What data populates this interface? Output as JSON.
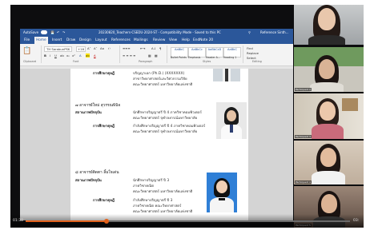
{
  "word": {
    "title": "20230820_Teachers-CSEDU-2024-ST - Compatibility Mode - Saved to this PC",
    "autosave_label": "AutoSave",
    "search_label": "Search",
    "account_label": "Reference Sinth...",
    "tabs": [
      "File",
      "Home",
      "Insert",
      "Draw",
      "Design",
      "Layout",
      "References",
      "Mailings",
      "Review",
      "View",
      "Help",
      "EndNote 20"
    ],
    "active_tab": "Home",
    "font_name": "TH SarabunPSK",
    "font_size": "+16",
    "styles": [
      "AaBbC",
      "AaBbCc",
      "AaBbCcD"
    ],
    "style_names": [
      "Bullet Points",
      "Emphasis",
      "Header A...",
      "Heading 1"
    ],
    "group_labels": [
      "Clipboard",
      "Font",
      "Paragraph",
      "Styles",
      "Editing"
    ],
    "editing_items": [
      "Find",
      "Replace",
      "Select"
    ]
  },
  "document": {
    "top_label": "การศึกษาดุษฎี",
    "top_lines": [
      "ปริญญาเอก (Ph.D.) (XXXXXXX)",
      "สาขาวิทยาศาสตร์และวิศวกรรมวิจัย",
      "คณะวิทยาศาสตร์ มหาวิทยาลัยแห่งชาติ"
    ],
    "sections": [
      {
        "header": "๗ อาจารย์ใหม่ สุวรรณพินิจ",
        "rows": [
          {
            "label": "สถานภาพปัจจุบัน",
            "lines": [
              "นักศึกษาปริญญาตรี ปี 4 ภาควิชาคอมพิวเตอร์",
              "คณะวิทยาศาสตร์ จุฬาลงกรณ์มหาวิทยาลัย"
            ]
          },
          {
            "label": "การศึกษาดุษฎี",
            "lines": [
              "กำลังศึกษาปริญญาตรี ปี 4 ภาควิชาคอมพิวเตอร์",
              "คณะวิทยาศาสตร์ จุฬาลงกรณ์มหาวิทยาลัย"
            ]
          }
        ]
      },
      {
        "header": "๘ อาจารย์ติดตา ลิ้มใจเด่น",
        "rows": [
          {
            "label": "สถานภาพปัจจุบัน",
            "lines": [
              "นักศึกษาปริญญาตรี ปี 3",
              "ภาควิชาคณิต",
              "คณะวิทยาศาสตร์ มหาวิทยาลัยแห่งชาติ"
            ]
          },
          {
            "label": "การศึกษาดุษฎี",
            "lines": [
              "กำลังศึกษาปริญญาตรี ปี 3",
              "ภาควิชาคณิต คณะวิทยาศาสตร์",
              "คณะวิทยาศาสตร์ มหาวิทยาลัยแห่งชาติ"
            ]
          }
        ]
      }
    ]
  },
  "participants": [
    {
      "name": ""
    },
    {
      "name": "Participant 2"
    },
    {
      "name": "Participant 3"
    },
    {
      "name": "Participant 4"
    },
    {
      "name": "Participant 5"
    }
  ],
  "player": {
    "current_time": "01:38",
    "total_time": "03:",
    "progress": 0.25
  },
  "colors": {
    "word_blue": "#2b579a",
    "progress_orange": "#e2611b"
  }
}
